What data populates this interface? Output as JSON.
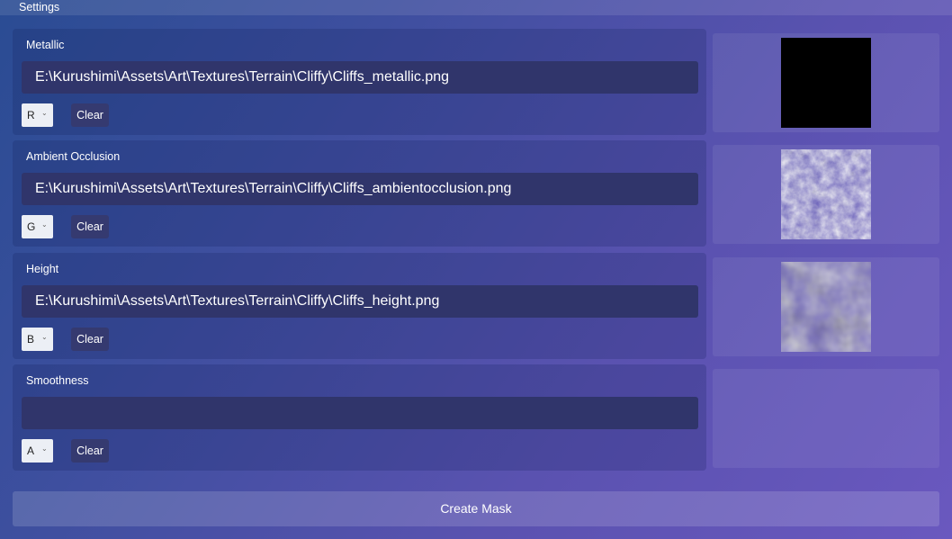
{
  "window": {
    "title": "Settings"
  },
  "maps": [
    {
      "label": "Metallic",
      "path": "E:\\Kurushimi\\Assets\\Art\\Textures\\Terrain\\Cliffy\\Cliffs_metallic.png",
      "channel": "R",
      "clear_label": "Clear",
      "preview": "black"
    },
    {
      "label": "Ambient Occlusion",
      "path": "E:\\Kurushimi\\Assets\\Art\\Textures\\Terrain\\Cliffy\\Cliffs_ambientocclusion.png",
      "channel": "G",
      "clear_label": "Clear",
      "preview": "ao-texture"
    },
    {
      "label": "Height",
      "path": "E:\\Kurushimi\\Assets\\Art\\Textures\\Terrain\\Cliffy\\Cliffs_height.png",
      "channel": "B",
      "clear_label": "Clear",
      "preview": "height-texture"
    },
    {
      "label": "Smoothness",
      "path": "",
      "channel": "A",
      "clear_label": "Clear",
      "preview": "none"
    }
  ],
  "actions": {
    "create_label": "Create Mask"
  },
  "icons": {
    "dropdown": "chevron-down-icon"
  }
}
